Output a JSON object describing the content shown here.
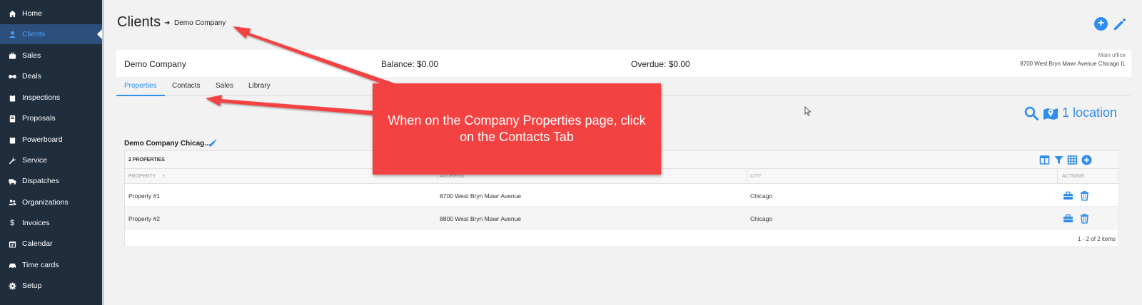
{
  "sidebar": {
    "items": [
      {
        "label": "Home",
        "icon": "home-icon"
      },
      {
        "label": "Clients",
        "icon": "user-icon",
        "active": true
      },
      {
        "label": "Sales",
        "icon": "briefcase-icon"
      },
      {
        "label": "Deals",
        "icon": "handshake-icon"
      },
      {
        "label": "Inspections",
        "icon": "clipboard-icon"
      },
      {
        "label": "Proposals",
        "icon": "document-icon"
      },
      {
        "label": "Powerboard",
        "icon": "clipboard-icon"
      },
      {
        "label": "Service",
        "icon": "wrench-icon"
      },
      {
        "label": "Dispatches",
        "icon": "truck-icon"
      },
      {
        "label": "Organizations",
        "icon": "users-icon"
      },
      {
        "label": "Invoices",
        "icon": "dollar-icon"
      },
      {
        "label": "Calendar",
        "icon": "calendar-icon"
      },
      {
        "label": "Time cards",
        "icon": "car-icon"
      },
      {
        "label": "Setup",
        "icon": "gear-icon"
      }
    ]
  },
  "header": {
    "title": "Clients",
    "arrow": "➜",
    "company": "Demo Company"
  },
  "summary": {
    "name": "Demo Company",
    "balance": "Balance: $0.00",
    "overdue": "Overdue: $0.00",
    "office_label": "Main office",
    "office_address": "8700 West Bryn Mawr Avenue Chicago IL"
  },
  "tabs": [
    {
      "label": "Properties",
      "active": true
    },
    {
      "label": "Contacts"
    },
    {
      "label": "Sales"
    },
    {
      "label": "Library"
    }
  ],
  "locations": {
    "text": "1 location"
  },
  "group": {
    "title": "Demo Company Chicag...",
    "count": "2 PROPERTIES",
    "columns": [
      "Property",
      "Address",
      "City",
      "Actions"
    ],
    "rows": [
      {
        "property": "Property #1",
        "address": "8700 West Bryn Mawr Avenue",
        "city": "Chicago"
      },
      {
        "property": "Property #2",
        "address": "8800 West Bryn Mawr Avenue",
        "city": "Chicago"
      }
    ],
    "pager": "1 - 2 of 2 items"
  },
  "annotation": {
    "text": "When on the Company Properties page, click on the Contacts Tab"
  },
  "colors": {
    "sidebar": "#1f2d3d",
    "accent": "#2f8cf0",
    "callout": "#f44242"
  }
}
